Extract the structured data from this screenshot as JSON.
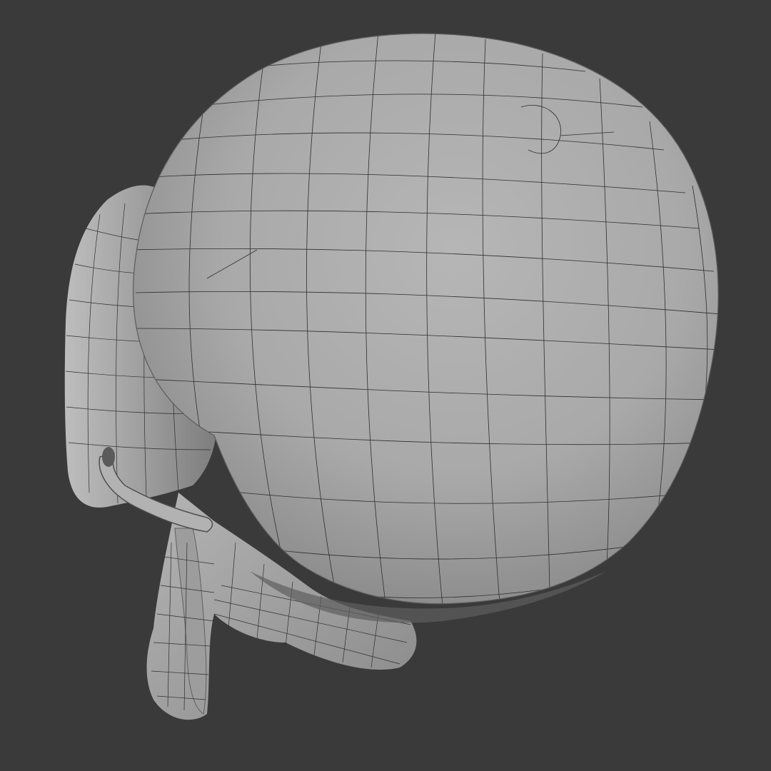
{
  "viewport": {
    "background_color": "#3a3a3a",
    "model": {
      "subject": "skull-mesh",
      "shading": "solid-matcap-gray",
      "wireframe_overlay": true,
      "surface_color": "#a8a8a8",
      "surface_highlight_color": "#b9b9b9",
      "surface_shadow_color": "#6f6f6f",
      "wire_color": "#2e2e2e"
    }
  }
}
